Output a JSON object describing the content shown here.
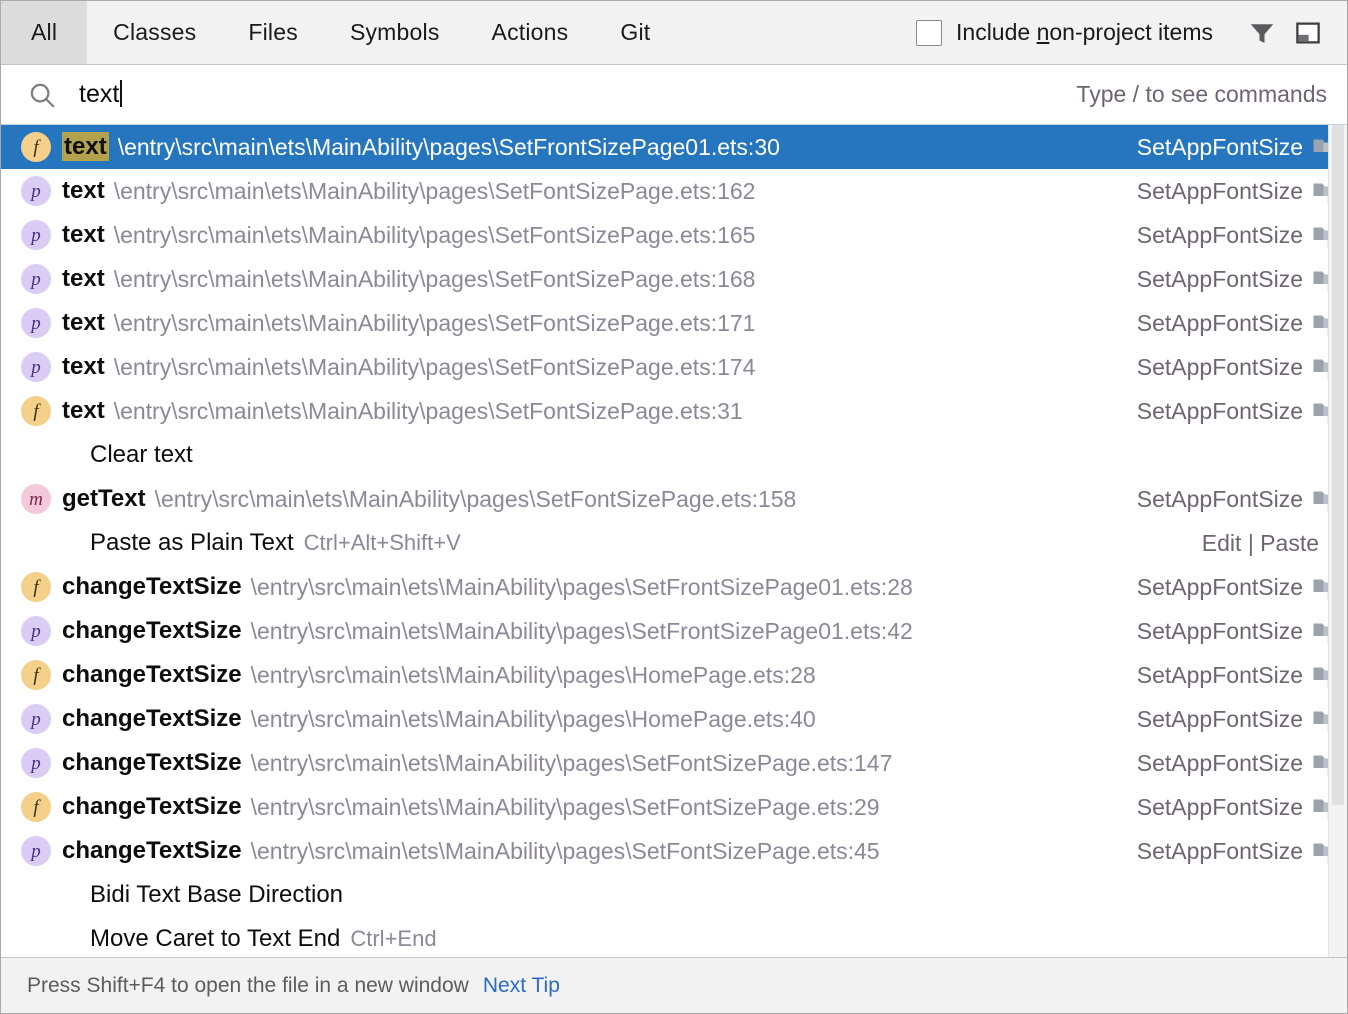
{
  "tabs": [
    {
      "label": "All",
      "active": true
    },
    {
      "label": "Classes",
      "active": false
    },
    {
      "label": "Files",
      "active": false
    },
    {
      "label": "Symbols",
      "active": false
    },
    {
      "label": "Actions",
      "active": false
    },
    {
      "label": "Git",
      "active": false
    }
  ],
  "toolbar": {
    "include_non_project_label_pre": "Include ",
    "include_non_project_mnemonic": "n",
    "include_non_project_label_post": "on-project items",
    "include_non_project_checked": false,
    "filter_icon": "filter-funnel-icon",
    "preview_icon": "preview-panel-icon"
  },
  "search": {
    "icon": "search-icon",
    "value": "text",
    "placeholder": "Type / to see commands",
    "hint": "Type / to see commands"
  },
  "results": [
    {
      "kind": "f",
      "name_pre": "",
      "name_match": "text",
      "name_post": "",
      "path": "\\entry\\src\\main\\ets\\MainAbility\\pages\\SetFrontSizePage01.ets:30",
      "module": "SetAppFontSize",
      "selected": true
    },
    {
      "kind": "p",
      "name_pre": "",
      "name_match": "",
      "name_post": "text",
      "path": "\\entry\\src\\main\\ets\\MainAbility\\pages\\SetFontSizePage.ets:162",
      "module": "SetAppFontSize",
      "selected": false
    },
    {
      "kind": "p",
      "name_pre": "",
      "name_match": "",
      "name_post": "text",
      "path": "\\entry\\src\\main\\ets\\MainAbility\\pages\\SetFontSizePage.ets:165",
      "module": "SetAppFontSize",
      "selected": false
    },
    {
      "kind": "p",
      "name_pre": "",
      "name_match": "",
      "name_post": "text",
      "path": "\\entry\\src\\main\\ets\\MainAbility\\pages\\SetFontSizePage.ets:168",
      "module": "SetAppFontSize",
      "selected": false
    },
    {
      "kind": "p",
      "name_pre": "",
      "name_match": "",
      "name_post": "text",
      "path": "\\entry\\src\\main\\ets\\MainAbility\\pages\\SetFontSizePage.ets:171",
      "module": "SetAppFontSize",
      "selected": false
    },
    {
      "kind": "p",
      "name_pre": "",
      "name_match": "",
      "name_post": "text",
      "path": "\\entry\\src\\main\\ets\\MainAbility\\pages\\SetFontSizePage.ets:174",
      "module": "SetAppFontSize",
      "selected": false
    },
    {
      "kind": "f",
      "name_pre": "",
      "name_match": "",
      "name_post": "text",
      "path": "\\entry\\src\\main\\ets\\MainAbility\\pages\\SetFontSizePage.ets:31",
      "module": "SetAppFontSize",
      "selected": false
    },
    {
      "kind": "action",
      "action_label": "Clear text",
      "shortcut": "",
      "right_text": "",
      "selected": false
    },
    {
      "kind": "m",
      "name_pre": "",
      "name_match": "",
      "name_post": "getText",
      "path": "\\entry\\src\\main\\ets\\MainAbility\\pages\\SetFontSizePage.ets:158",
      "module": "SetAppFontSize",
      "selected": false
    },
    {
      "kind": "action",
      "action_label": "Paste as Plain Text",
      "shortcut": "Ctrl+Alt+Shift+V",
      "right_text": "Edit | Paste",
      "selected": false
    },
    {
      "kind": "f",
      "name_pre": "",
      "name_match": "",
      "name_post": "changeTextSize",
      "path": "\\entry\\src\\main\\ets\\MainAbility\\pages\\SetFrontSizePage01.ets:28",
      "module": "SetAppFontSize",
      "selected": false
    },
    {
      "kind": "p",
      "name_pre": "",
      "name_match": "",
      "name_post": "changeTextSize",
      "path": "\\entry\\src\\main\\ets\\MainAbility\\pages\\SetFrontSizePage01.ets:42",
      "module": "SetAppFontSize",
      "selected": false
    },
    {
      "kind": "f",
      "name_pre": "",
      "name_match": "",
      "name_post": "changeTextSize",
      "path": "\\entry\\src\\main\\ets\\MainAbility\\pages\\HomePage.ets:28",
      "module": "SetAppFontSize",
      "selected": false
    },
    {
      "kind": "p",
      "name_pre": "",
      "name_match": "",
      "name_post": "changeTextSize",
      "path": "\\entry\\src\\main\\ets\\MainAbility\\pages\\HomePage.ets:40",
      "module": "SetAppFontSize",
      "selected": false
    },
    {
      "kind": "p",
      "name_pre": "",
      "name_match": "",
      "name_post": "changeTextSize",
      "path": "\\entry\\src\\main\\ets\\MainAbility\\pages\\SetFontSizePage.ets:147",
      "module": "SetAppFontSize",
      "selected": false
    },
    {
      "kind": "f",
      "name_pre": "",
      "name_match": "",
      "name_post": "changeTextSize",
      "path": "\\entry\\src\\main\\ets\\MainAbility\\pages\\SetFontSizePage.ets:29",
      "module": "SetAppFontSize",
      "selected": false
    },
    {
      "kind": "p",
      "name_pre": "",
      "name_match": "",
      "name_post": "changeTextSize",
      "path": "\\entry\\src\\main\\ets\\MainAbility\\pages\\SetFontSizePage.ets:45",
      "module": "SetAppFontSize",
      "selected": false
    },
    {
      "kind": "action",
      "action_label": "Bidi Text Base Direction",
      "shortcut": "",
      "right_text": "",
      "selected": false
    },
    {
      "kind": "action",
      "action_label": "Move Caret to Text End",
      "shortcut": "Ctrl+End",
      "right_text": "",
      "selected": false
    }
  ],
  "status": {
    "tip": "Press Shift+F4 to open the file in a new window",
    "link": "Next Tip"
  },
  "colors": {
    "selection": "#2675bf",
    "match_highlight": "#b2a24d",
    "link": "#2a6bc4",
    "path_text": "#8e8796",
    "module_text": "#6e6472"
  }
}
